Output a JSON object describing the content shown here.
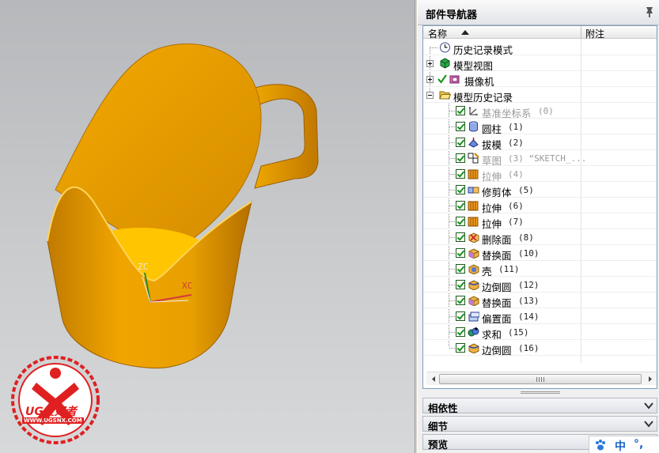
{
  "viewport": {
    "axis_labels": {
      "z": "ZC",
      "x": "XC"
    },
    "watermark": {
      "brand": "UG爱好者",
      "url": "WWW.UGSNX.COM"
    },
    "colors": {
      "model": "#f0a800",
      "model_shadow": "#c07800",
      "inner_floor": "#ffc400",
      "background": "#c5c7c9"
    }
  },
  "navigator": {
    "title": "部件导航器",
    "pin_icon": "pin-icon",
    "columns": {
      "name": "名称",
      "note": "附注"
    },
    "root_items": [
      {
        "label": "历史记录模式",
        "icon": "clock-icon"
      },
      {
        "label": "模型视图",
        "icon": "model-views-icon",
        "expander": "plus"
      },
      {
        "label": "摄像机",
        "icon": "camera-icon",
        "expander": "plus",
        "checked_mark": true
      },
      {
        "label": "模型历史记录",
        "icon": "folder-open-icon",
        "expander": "minus"
      }
    ],
    "history": [
      {
        "label": "基准坐标系",
        "num": "(0)",
        "icon": "datum-csys-icon",
        "grey": true
      },
      {
        "label": "圆柱",
        "num": "(1)",
        "icon": "cylinder-icon",
        "grey": false
      },
      {
        "label": "拔模",
        "num": "(2)",
        "icon": "draft-icon",
        "grey": false
      },
      {
        "label": "草图",
        "num": "(3) “SKETCH_...",
        "icon": "sketch-icon",
        "grey": true
      },
      {
        "label": "拉伸",
        "num": "(4)",
        "icon": "extrude-icon",
        "grey": true
      },
      {
        "label": "修剪体",
        "num": "(5)",
        "icon": "trim-body-icon",
        "grey": false
      },
      {
        "label": "拉伸",
        "num": "(6)",
        "icon": "extrude-icon",
        "grey": false
      },
      {
        "label": "拉伸",
        "num": "(7)",
        "icon": "extrude-icon",
        "grey": false
      },
      {
        "label": "删除面",
        "num": "(8)",
        "icon": "delete-face-icon",
        "grey": false
      },
      {
        "label": "替换面",
        "num": "(10)",
        "icon": "replace-face-icon",
        "grey": false
      },
      {
        "label": "壳",
        "num": "(11)",
        "icon": "shell-icon",
        "grey": false
      },
      {
        "label": "边倒圆",
        "num": "(12)",
        "icon": "edge-blend-icon",
        "grey": false
      },
      {
        "label": "替换面",
        "num": "(13)",
        "icon": "replace-face-icon",
        "grey": false
      },
      {
        "label": "偏置面",
        "num": "(14)",
        "icon": "offset-face-icon",
        "grey": false
      },
      {
        "label": "求和",
        "num": "(15)",
        "icon": "unite-icon",
        "grey": false
      },
      {
        "label": "边倒圆",
        "num": "(16)",
        "icon": "edge-blend-icon",
        "grey": false
      }
    ],
    "scroll_grip": "III",
    "sections": [
      {
        "label": "相依性"
      },
      {
        "label": "细节"
      },
      {
        "label": "预览"
      }
    ]
  },
  "ime": {
    "zh": "中",
    "punct": "°,"
  }
}
